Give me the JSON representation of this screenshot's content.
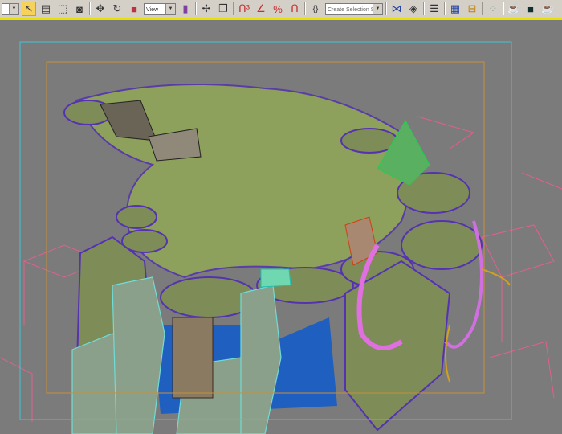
{
  "toolbar": {
    "selection_filter_value": "",
    "reference_coord_value": "View",
    "named_selection_placeholder": "Create Selection Set",
    "icons": [
      "select-object",
      "select-by-name",
      "rectangular-selection-region",
      "window-crossing",
      "select-and-move",
      "select-and-rotate",
      "select-and-scale",
      "reference-coordinate-system",
      "use-pivot-center",
      "select-and-manipulate",
      "keyboard-shortcut-override",
      "snaps-toggle-3",
      "angle-snap",
      "percent-snap",
      "spinner-snap",
      "edit-named-selection",
      "mirror",
      "align",
      "layer-manager",
      "curve-editor",
      "schematic-view",
      "material-editor",
      "render-setup",
      "rendered-frame-window",
      "quick-render"
    ]
  },
  "viewport": {
    "safe_frame_color": "#3fc6d8",
    "render_frame_color": "#c8903a",
    "background": "#7b7b7b"
  }
}
